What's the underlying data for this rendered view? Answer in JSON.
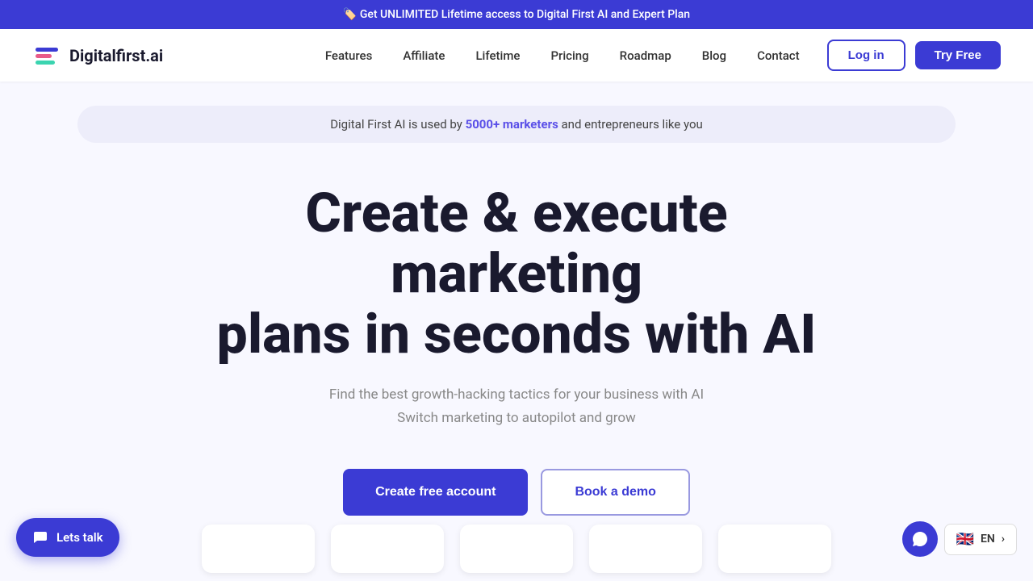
{
  "announcement_bar": {
    "icon": "🏷️",
    "text": "Get UNLIMITED Lifetime access  to Digital First AI and Expert Plan"
  },
  "navbar": {
    "logo_text": "Digitalfirst.ai",
    "nav_items": [
      {
        "label": "Features",
        "href": "#"
      },
      {
        "label": "Affiliate",
        "href": "#"
      },
      {
        "label": "Lifetime",
        "href": "#"
      },
      {
        "label": "Pricing",
        "href": "#"
      },
      {
        "label": "Roadmap",
        "href": "#"
      },
      {
        "label": "Blog",
        "href": "#"
      },
      {
        "label": "Contact",
        "href": "#"
      }
    ],
    "login_label": "Log in",
    "try_label": "Try Free"
  },
  "hero": {
    "announcement_prefix": "Digital First AI is used by",
    "announcement_highlight": "5000+ marketers",
    "announcement_suffix": "and entrepreneurs like you",
    "heading_line1": "Create & execute marketing",
    "heading_line2": "plans in seconds with AI",
    "subtext_line1": "Find the best growth-hacking tactics for your business with AI",
    "subtext_line2": "Switch marketing to autopilot and grow",
    "cta_create": "Create free account",
    "cta_demo": "Book a demo"
  },
  "widgets": {
    "chat_label": "Lets talk",
    "lang_code": "EN"
  },
  "colors": {
    "brand_blue": "#3b3bd4",
    "highlight_purple": "#5b50e8"
  }
}
